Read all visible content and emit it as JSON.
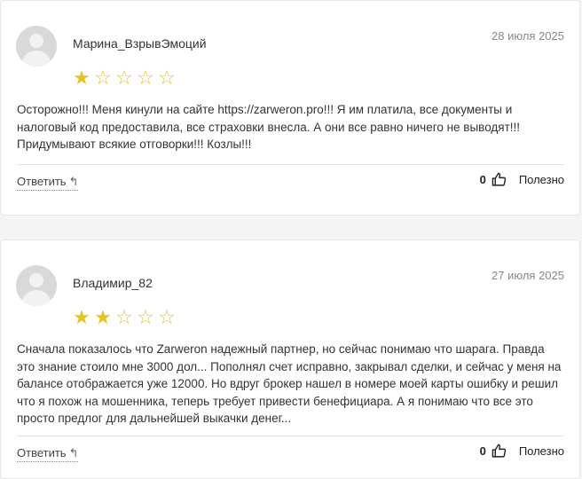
{
  "reviews": [
    {
      "author": "Марина_ВзрывЭмоций",
      "date": "28 июля 2025",
      "rating": 1,
      "max_rating": 5,
      "text": "Осторожно!!! Меня кинули на сайте https://zarweron.pro!!! Я им платила, все документы и налоговый код предоставила, все страховки внесла. А они все равно ничего не выводят!!! Придумывают всякие отговорки!!! Козлы!!!",
      "reply_label": "Ответить",
      "likes": "0",
      "useful_label": "Полезно"
    },
    {
      "author": "Владимир_82",
      "date": "27 июля 2025",
      "rating": 2,
      "max_rating": 5,
      "text": "Сначала показалось что Zarweron надежный партнер, но сейчас понимаю что шарага. Правда это знание стоило мне 3000 дол... Пополнял счет исправно, закрывал сделки, и сейчас у меня на балансе отображается уже 12000. Но вдруг брокер нашел в номере моей карты ошибку и решил что я похож на мошенника, теперь требует привести бенефициара. А я понимаю что все это просто предлог для дальнейшей выкачки денег...",
      "reply_label": "Ответить",
      "likes": "0",
      "useful_label": "Полезно"
    }
  ],
  "colors": {
    "star": "#e8c41b",
    "text": "#333333",
    "date": "#888888"
  }
}
